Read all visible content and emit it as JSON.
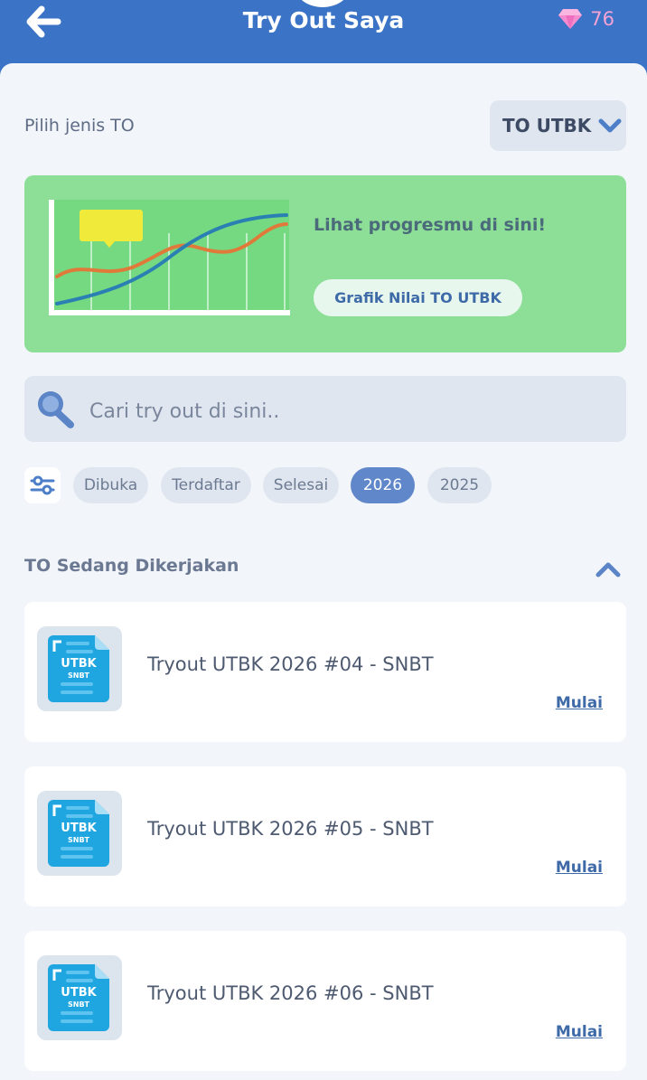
{
  "header": {
    "title": "Try Out Saya",
    "gem_count": "76",
    "back_icon": "arrow-left-icon",
    "gem_icon": "diamond-icon"
  },
  "type_picker": {
    "label": "Pilih jenis TO",
    "selected": "TO UTBK"
  },
  "progress_card": {
    "text": "Lihat progresmu di sini!",
    "button_label": "Grafik Nilai TO UTBK"
  },
  "search": {
    "placeholder": "Cari try out di sini.."
  },
  "filters": {
    "chips": [
      "Dibuka",
      "Terdaftar",
      "Selesai",
      "2026",
      "2025"
    ],
    "active": "2026"
  },
  "section": {
    "title": "TO Sedang Dikerjakan"
  },
  "tryouts": [
    {
      "badge": "UTBK",
      "sub_badge": "SNBT",
      "title": "Tryout UTBK 2026 #04 - SNBT",
      "action": "Mulai"
    },
    {
      "badge": "UTBK",
      "sub_badge": "SNBT",
      "title": "Tryout UTBK 2026 #05 - SNBT",
      "action": "Mulai"
    },
    {
      "badge": "UTBK",
      "sub_badge": "SNBT",
      "title": "Tryout UTBK 2026 #06 - SNBT",
      "action": "Mulai"
    }
  ],
  "colors": {
    "header": "#3b73c6",
    "progress_card": "#8ddf98",
    "active_chip": "#5f87c9",
    "link": "#3e6aa8"
  }
}
